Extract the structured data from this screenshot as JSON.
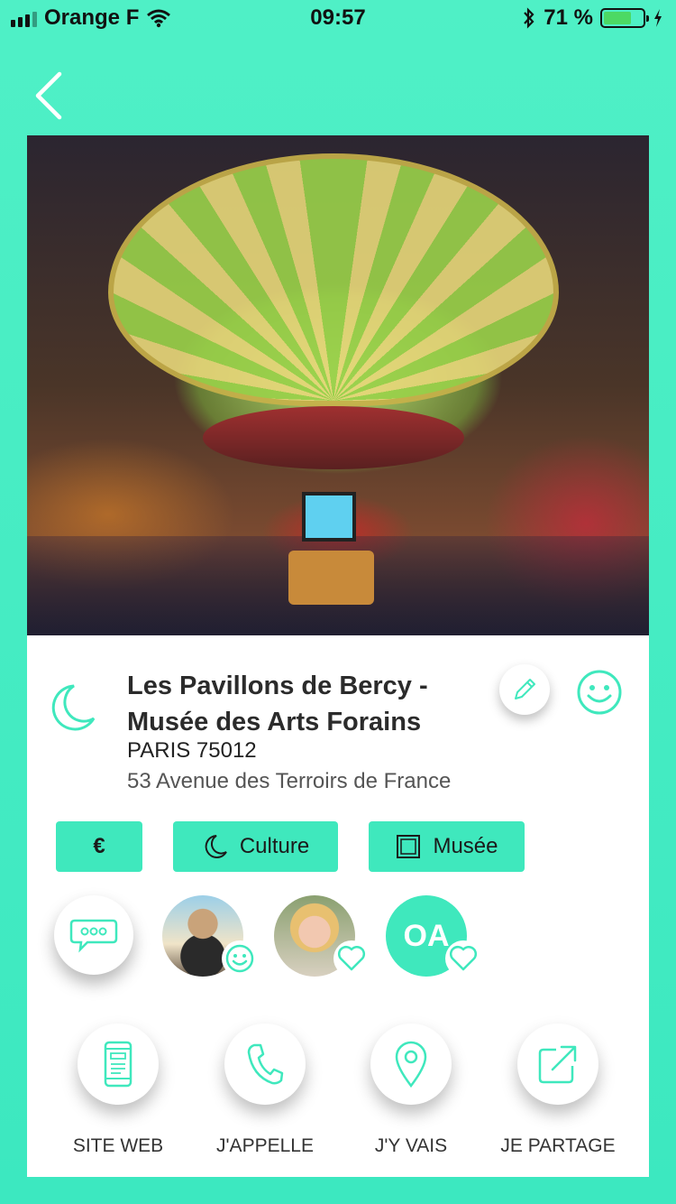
{
  "status_bar": {
    "carrier": "Orange F",
    "time": "09:57",
    "battery_percent": "71 %",
    "battery_level": 0.71
  },
  "venue": {
    "name": "Les Pavillons de Bercy - Musée des Arts Forains",
    "city": "PARIS 75012",
    "address": "53 Avenue des Terroirs de France"
  },
  "tags": {
    "price": "€",
    "category": "Culture",
    "type": "Musée"
  },
  "friends": {
    "initials": "OA"
  },
  "actions": {
    "website": "SITE WEB",
    "call": "J'APPELLE",
    "go": "J'Y VAIS",
    "share": "JE PARTAGE"
  },
  "colors": {
    "accent": "#3fe8bd",
    "background": "#4ff0c6"
  },
  "icons": [
    "back-chevron-icon",
    "moon-icon",
    "pencil-icon",
    "smiley-icon",
    "chat-bubble-icon",
    "heart-icon",
    "phone-web-icon",
    "phone-icon",
    "location-pin-icon",
    "share-icon",
    "frame-icon",
    "wifi-icon",
    "bluetooth-icon",
    "battery-icon",
    "charging-icon"
  ]
}
